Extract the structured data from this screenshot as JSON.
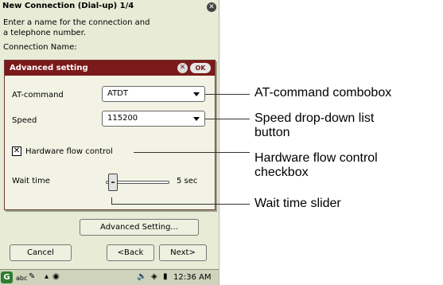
{
  "window": {
    "title": "New Connection (Dial-up) 1/4",
    "prompt_line1": "Enter a name for the connection and",
    "prompt_line2": "a telephone number.",
    "connection_name_label": "Connection Name:"
  },
  "dialog": {
    "title": "Advanced setting",
    "ok_label": "OK",
    "at_command_label": "AT-command",
    "at_command_value": "ATDT",
    "speed_label": "Speed",
    "speed_value": "115200",
    "flow_control_label": "Hardware flow control",
    "flow_control_checked": true,
    "wait_time_label": "Wait time",
    "wait_time_value": "5 sec",
    "wait_time_level": 0.05
  },
  "buttons": {
    "advanced_setting": "Advanced Setting...",
    "cancel": "Cancel",
    "back": "<Back",
    "next": "Next>"
  },
  "taskbar": {
    "input_mode": "abc",
    "clock": "12:36 AM"
  },
  "callouts": {
    "at_command": "AT-command combobox",
    "speed_line1": "Speed drop-down list",
    "speed_line2": "button",
    "flow_line1": "Hardware flow control",
    "flow_line2": "checkbox",
    "wait_time": "Wait time slider"
  },
  "icons": {
    "close": "close-icon",
    "dropdown": "chevron-down-icon",
    "start": "start-icon",
    "pen": "pen-icon",
    "speaker": "speaker-icon",
    "network": "network-icon",
    "battery": "battery-icon"
  },
  "colors": {
    "dialog_title_bg": "#7b1a1a",
    "screen_bg": "#e8ebd6",
    "taskbar_bg": "#cfd3bc"
  }
}
